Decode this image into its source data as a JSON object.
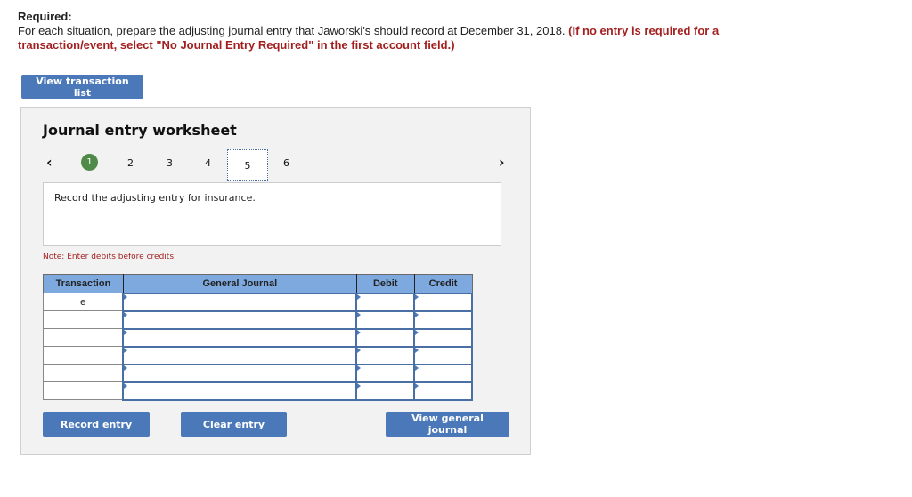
{
  "required": {
    "title": "Required:",
    "instruction": "For each situation, prepare the adjusting journal entry that Jaworski's should record at December 31, 2018.",
    "warning": "(If no entry is required for a transaction/event, select \"No Journal Entry Required\" in the first account field.)"
  },
  "buttons": {
    "view_transaction_list": "View transaction list",
    "record_entry": "Record entry",
    "clear_entry": "Clear entry",
    "view_general_journal": "View general journal"
  },
  "worksheet": {
    "title": "Journal entry worksheet",
    "pager": {
      "prev_icon": "‹",
      "next_icon": "›",
      "pages": [
        "1",
        "2",
        "3",
        "4",
        "5",
        "6"
      ],
      "completed_page": "1",
      "current_page": "5"
    },
    "instruction_text": "Record the adjusting entry for insurance.",
    "note": "Note: Enter debits before credits.",
    "table": {
      "headers": [
        "Transaction",
        "General Journal",
        "Debit",
        "Credit"
      ],
      "rows": [
        {
          "transaction": "e",
          "account": "",
          "debit": "",
          "credit": ""
        },
        {
          "transaction": "",
          "account": "",
          "debit": "",
          "credit": ""
        },
        {
          "transaction": "",
          "account": "",
          "debit": "",
          "credit": ""
        },
        {
          "transaction": "",
          "account": "",
          "debit": "",
          "credit": ""
        },
        {
          "transaction": "",
          "account": "",
          "debit": "",
          "credit": ""
        },
        {
          "transaction": "",
          "account": "",
          "debit": "",
          "credit": ""
        }
      ]
    }
  },
  "colors": {
    "button_blue": "#4a78b8",
    "header_blue": "#7ea9df",
    "completed_green": "#4f8a48",
    "warning_red": "#a31f1f"
  }
}
